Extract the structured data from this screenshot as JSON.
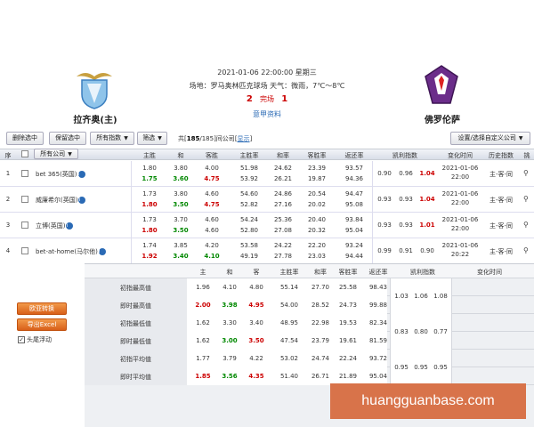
{
  "match": {
    "home_team": "拉齐奥(主)",
    "away_team": "佛罗伦萨",
    "datetime": "2021-01-06 22:00:00 星期三",
    "venue_weather": "场地：罗马奥林匹克球场 天气：微雨，7℃～8℃",
    "home_score": "2",
    "status": "完场",
    "away_score": "1",
    "league_link": "意甲资料"
  },
  "toolbar": {
    "delete_selected": "删除选中",
    "keep_selected": "保留选中",
    "all_indices": "所有指数",
    "filter": "筛选",
    "stat_prefix": "共[",
    "stat_count": "185",
    "stat_middle": "/185]间公司",
    "stat_show": "显示",
    "settings": "设置/选择自定义公司"
  },
  "table": {
    "headers": {
      "seq": "序",
      "company_select": "所有公司",
      "main": "主胜",
      "draw": "和",
      "away": "客胜",
      "home_rate": "主胜率",
      "draw_rate": "和率",
      "away_rate": "客胜率",
      "return_rate": "返还率",
      "kelly": "凯利指数",
      "change_time": "变化时间",
      "history": "历史指数",
      "settle": "挑"
    },
    "rows": [
      {
        "seq": "1",
        "company": "bet 365(英国)",
        "init": [
          "1.80",
          "3.80",
          "4.00",
          "51.98",
          "24.62",
          "23.39",
          "93.57"
        ],
        "live": [
          "1.75",
          "3.60",
          "4.75",
          "53.92",
          "26.21",
          "19.87",
          "94.36"
        ],
        "kelly": [
          "0.90",
          "0.96",
          "1.04"
        ],
        "time_date": "2021-01-06",
        "time_clock": "22:00",
        "history": "主-客-同"
      },
      {
        "seq": "2",
        "company": "威廉希尔(英国)",
        "init": [
          "1.73",
          "3.80",
          "4.60",
          "54.60",
          "24.86",
          "20.54",
          "94.47"
        ],
        "live": [
          "1.80",
          "3.50",
          "4.75",
          "52.82",
          "27.16",
          "20.02",
          "95.08"
        ],
        "kelly": [
          "0.93",
          "0.93",
          "1.04"
        ],
        "time_date": "2021-01-06",
        "time_clock": "22:00",
        "history": "主-客-同"
      },
      {
        "seq": "3",
        "company": "立博(英国)",
        "init": [
          "1.73",
          "3.70",
          "4.60",
          "54.24",
          "25.36",
          "20.40",
          "93.84"
        ],
        "live": [
          "1.80",
          "3.50",
          "4.60",
          "52.80",
          "27.08",
          "20.32",
          "95.04"
        ],
        "kelly": [
          "0.93",
          "0.93",
          "1.01"
        ],
        "time_date": "2021-01-06",
        "time_clock": "22:00",
        "history": "主-客-同"
      },
      {
        "seq": "4",
        "company": "bet-at-home(马尔他)",
        "init": [
          "1.74",
          "3.85",
          "4.20",
          "53.58",
          "24.22",
          "22.20",
          "93.24"
        ],
        "live": [
          "1.92",
          "3.40",
          "4.10",
          "49.19",
          "27.78",
          "23.03",
          "94.44"
        ],
        "kelly": [
          "0.99",
          "0.91",
          "0.90"
        ],
        "time_date": "2021-01-06",
        "time_clock": "20:22",
        "history": "主-客-同"
      }
    ]
  },
  "summary": {
    "headers": {
      "main": "主",
      "draw": "和",
      "away": "客",
      "home_rate": "主胜率",
      "draw_rate": "和率",
      "away_rate": "客胜率",
      "return_rate": "返还率",
      "kelly": "凯利指数",
      "change_time": "变化时间"
    },
    "rows": [
      {
        "label": "初指最高值",
        "values": [
          "1.96",
          "4.10",
          "4.80",
          "55.14",
          "27.70",
          "25.58",
          "98.43"
        ]
      },
      {
        "label": "即时最高值",
        "values": [
          "2.00",
          "3.98",
          "4.95",
          "54.00",
          "28.52",
          "24.73",
          "99.88"
        ]
      },
      {
        "label": "初指最低值",
        "values": [
          "1.62",
          "3.30",
          "3.40",
          "48.95",
          "22.98",
          "19.53",
          "82.34"
        ]
      },
      {
        "label": "即时最低值",
        "values": [
          "1.62",
          "3.00",
          "3.50",
          "47.54",
          "23.79",
          "19.61",
          "81.59"
        ]
      },
      {
        "label": "初指平均值",
        "values": [
          "1.77",
          "3.79",
          "4.22",
          "53.02",
          "24.74",
          "22.24",
          "93.72"
        ]
      },
      {
        "label": "即时平均值",
        "values": [
          "1.85",
          "3.56",
          "4.35",
          "51.40",
          "26.71",
          "21.89",
          "95.04"
        ]
      }
    ],
    "kelly_groups": [
      [
        "1.03",
        "1.06",
        "1.08"
      ],
      [
        "0.83",
        "0.80",
        "0.77"
      ],
      [
        "0.95",
        "0.95",
        "0.95"
      ]
    ],
    "buttons": {
      "convert": "欧亚转换",
      "export": "导出Excel",
      "float_header": "头尾浮动"
    }
  },
  "watermark": "huangguanbase.com",
  "colors": {
    "accent_red": "#cc0000",
    "accent_green": "#008800",
    "link_blue": "#2a6ab5",
    "orange": "#d8601a"
  }
}
